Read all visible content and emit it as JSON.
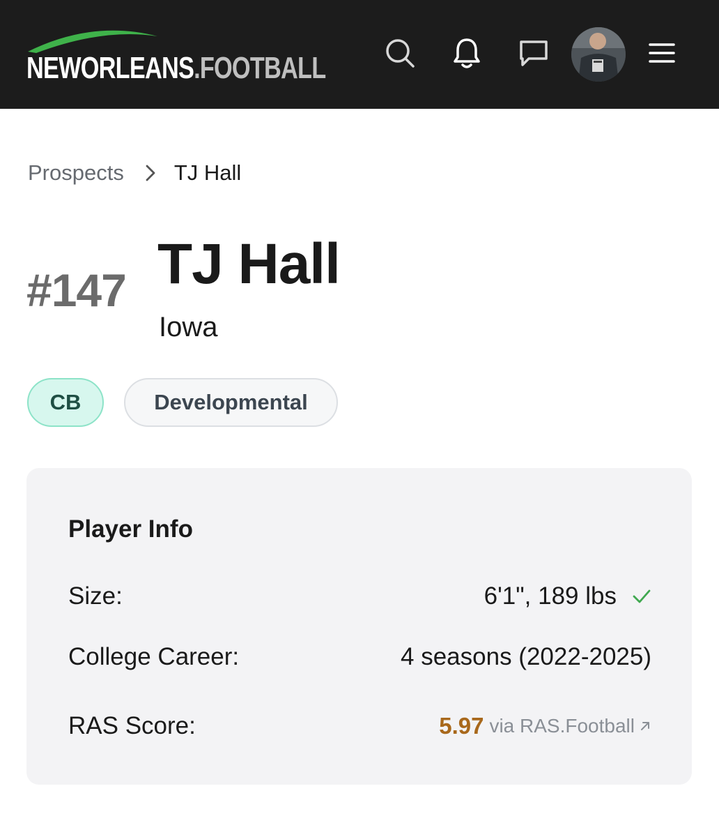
{
  "header": {
    "logo_main": "NEWORLEANS",
    "logo_tld": ".FOOTBALL",
    "brand_color": "#3fb24a",
    "icons": [
      "search-icon",
      "bell-icon",
      "chat-icon",
      "avatar",
      "menu-icon"
    ]
  },
  "breadcrumb": {
    "parent": "Prospects",
    "current": "TJ Hall"
  },
  "player": {
    "rank": "#147",
    "name": "TJ Hall",
    "school": "Iowa",
    "position_tag": "CB",
    "category_tag": "Developmental"
  },
  "player_info": {
    "title": "Player Info",
    "size_label": "Size:",
    "size_value": "6'1\", 189 lbs",
    "career_label": "College Career:",
    "career_value": "4 seasons (2022-2025)",
    "ras_label": "RAS Score:",
    "ras_value": "5.97",
    "ras_source": "via RAS.Football",
    "ras_color": "#a8681b",
    "check_color": "#3fa84f"
  }
}
